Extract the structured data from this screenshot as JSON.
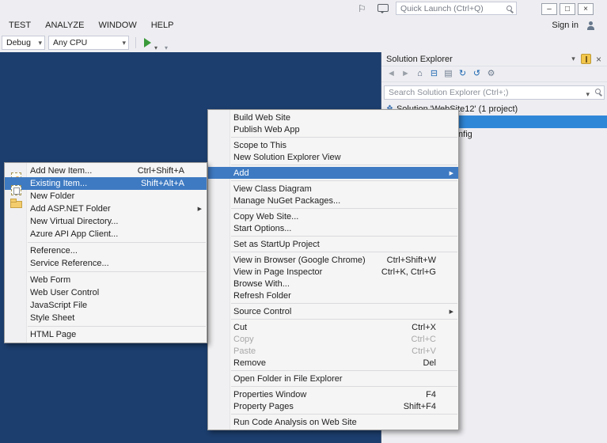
{
  "theme": {
    "main_background": "#1c3e6e",
    "chrome_background": "#eeeef2",
    "panel_background": "#eeeef2",
    "selection_blue": "#2f87d8",
    "menu_highlight": "#3e7ac2",
    "menu_background": "#f5f5f5"
  },
  "titlebar": {
    "flag_glyph": "⚐",
    "quick_launch_placeholder": "Quick Launch (Ctrl+Q)",
    "window_buttons": [
      {
        "name": "minimize-button",
        "glyph": "–"
      },
      {
        "name": "restore-button",
        "glyph": "□"
      },
      {
        "name": "close-button",
        "glyph": "×"
      }
    ]
  },
  "menubar": {
    "items": [
      "TEST",
      "ANALYZE",
      "WINDOW",
      "HELP"
    ],
    "sign_in_label": "Sign in"
  },
  "toolbar": {
    "debug_target": "Debug",
    "platform": "Any CPU"
  },
  "solution_explorer": {
    "title": "Solution Explorer",
    "search_placeholder": "Search Solution Explorer (Ctrl+;)",
    "toolbar_icons": [
      {
        "name": "back-icon",
        "glyph": "◄",
        "color": "#9aa0a8"
      },
      {
        "name": "forward-icon",
        "glyph": "►",
        "color": "#9aa0a8"
      },
      {
        "name": "home-icon",
        "glyph": "⌂",
        "color": "#41516d"
      },
      {
        "name": "collapse-all-icon",
        "glyph": "⊟",
        "color": "#1c66b0"
      },
      {
        "name": "show-all-files-icon",
        "glyph": "▤",
        "color": "#6d7c8e"
      },
      {
        "name": "refresh-icon",
        "glyph": "↻",
        "color": "#1c66b0"
      },
      {
        "name": "sync-with-active-document-icon",
        "glyph": "↺",
        "color": "#1c66b0"
      },
      {
        "name": "properties-icon",
        "glyph": "⚙",
        "color": "#6d7c8e"
      }
    ],
    "tree": {
      "solution_icon": "❖",
      "solution_label": "Solution 'WebSite12' (1 project)",
      "children": [
        {
          "label": "Web.config",
          "glyph": "⚙"
        }
      ]
    }
  },
  "context_menu": {
    "items": [
      {
        "label": "Build Web Site",
        "icon": "build",
        "glyph": "▦",
        "color": "#6d7c8e"
      },
      {
        "label": "Publish Web App",
        "icon": "publish",
        "glyph": "⊕",
        "color": "#1c66b0"
      },
      {
        "separator": true
      },
      {
        "label": "Scope to This"
      },
      {
        "label": "New Solution Explorer View",
        "icon": "new-solution-explorer-view",
        "glyph": "❖",
        "color": "#6d7c8e"
      },
      {
        "separator": true
      },
      {
        "label": "Add",
        "name": "menu-item-add",
        "submenu": true,
        "highlighted": true
      },
      {
        "separator": true
      },
      {
        "label": "View Class Diagram",
        "icon": "class-diagram",
        "glyph": "⊞",
        "color": "#6d7c8e"
      },
      {
        "label": "Manage NuGet Packages...",
        "icon": "nuget",
        "glyph": "◆",
        "color": "#004880"
      },
      {
        "separator": true
      },
      {
        "label": "Copy Web Site...",
        "icon": "copy-web-site",
        "glyph": "▣",
        "color": "#6d7c8e"
      },
      {
        "label": "Start Options...",
        "icon": "start-options",
        "glyph": "⚙",
        "color": "#6d7c8e"
      },
      {
        "separator": true
      },
      {
        "label": "Set as StartUp Project"
      },
      {
        "separator": true
      },
      {
        "label": "View in Browser (Google Chrome)",
        "shortcut": "Ctrl+Shift+W",
        "icon": "view-in-browser",
        "glyph": "◉",
        "color": "#2f7fd0"
      },
      {
        "label": "View in Page Inspector",
        "shortcut": "Ctrl+K, Ctrl+G",
        "icon": "page-inspector",
        "glyph": "◎",
        "color": "#7a5fb0"
      },
      {
        "label": "Browse With..."
      },
      {
        "label": "Refresh Folder",
        "icon": "refresh",
        "glyph": "↻",
        "color": "#1c66b0"
      },
      {
        "separator": true
      },
      {
        "label": "Source Control",
        "submenu": true
      },
      {
        "separator": true
      },
      {
        "label": "Cut",
        "shortcut": "Ctrl+X",
        "icon": "cut",
        "glyph": "✂",
        "color": "#3a3a3a"
      },
      {
        "label": "Copy",
        "shortcut": "Ctrl+C",
        "icon": "copy",
        "glyph": "▤",
        "color": "#b4b4b4",
        "disabled": true
      },
      {
        "label": "Paste",
        "shortcut": "Ctrl+V",
        "icon": "paste",
        "glyph": "▨",
        "color": "#b4b4b4",
        "disabled": true
      },
      {
        "label": "Remove",
        "shortcut": "Del",
        "icon": "remove",
        "glyph": "✗",
        "color": "#c8281e"
      },
      {
        "separator": true
      },
      {
        "label": "Open Folder in File Explorer",
        "icon": "open-folder",
        "glyph": "↪",
        "color": "#1c66b0"
      },
      {
        "separator": true
      },
      {
        "label": "Properties Window",
        "shortcut": "F4",
        "icon": "properties-window",
        "glyph": "⚙",
        "color": "#6d7c8e"
      },
      {
        "label": "Property Pages",
        "shortcut": "Shift+F4",
        "icon": "property-pages",
        "glyph": "▤",
        "color": "#6d7c8e"
      },
      {
        "separator": true
      },
      {
        "label": "Run Code Analysis on Web Site"
      }
    ]
  },
  "add_submenu": {
    "items": [
      {
        "label": "Add New Item...",
        "shortcut": "Ctrl+Shift+A",
        "icon": "add-new-item"
      },
      {
        "label": "Existing Item...",
        "name": "menu-item-existing-item",
        "shortcut": "Shift+Alt+A",
        "icon": "existing-item",
        "highlighted": true
      },
      {
        "label": "New Folder",
        "icon": "new-folder"
      },
      {
        "label": "Add ASP.NET Folder",
        "submenu": true
      },
      {
        "label": "New Virtual Directory..."
      },
      {
        "label": "Azure API App Client..."
      },
      {
        "separator": true
      },
      {
        "label": "Reference..."
      },
      {
        "label": "Service Reference..."
      },
      {
        "separator": true
      },
      {
        "label": "Web Form"
      },
      {
        "label": "Web User Control"
      },
      {
        "label": "JavaScript File"
      },
      {
        "label": "Style Sheet"
      },
      {
        "separator": true
      },
      {
        "label": "HTML Page"
      }
    ]
  }
}
